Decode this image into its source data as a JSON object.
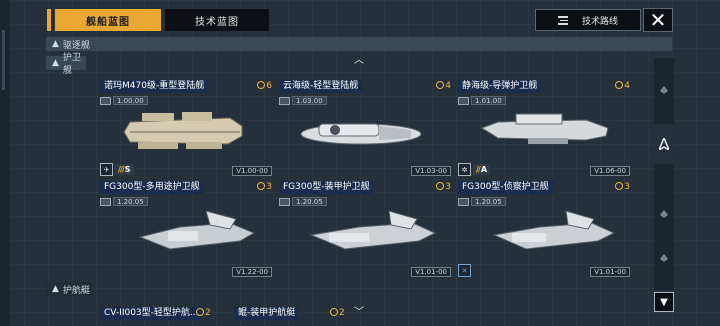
{
  "tabs": {
    "ships": "舰船蓝图",
    "tech": "技术蓝图"
  },
  "header": {
    "route_label": "技术路线",
    "route_icon": "route-list-icon",
    "close_icon": "close-icon"
  },
  "sections": {
    "destroyer": "驱逐舰",
    "frigate": "护卫舰",
    "escort": "护航艇"
  },
  "cards": [
    {
      "title": "诺玛M470级-重型登陆舰",
      "count": "6",
      "version": "1.00.00",
      "code": "V1.00-00",
      "rank": "S",
      "badge_icon": "airstrike-icon"
    },
    {
      "title": "云海级-轻型登陆舰",
      "count": "4",
      "version": "1.03.00",
      "code": "V1.03-00",
      "rank": "",
      "badge_icon": ""
    },
    {
      "title": "静海级-导弹护卫舰",
      "count": "4",
      "version": "1.01.00",
      "code": "V1.06-00",
      "rank": "A",
      "badge_icon": "gear-icon"
    },
    {
      "title": "FG300型-多用途护卫舰",
      "count": "3",
      "version": "1.20.05",
      "code": "V1.22-00",
      "rank": "",
      "badge_icon": ""
    },
    {
      "title": "FG300型-装甲护卫舰",
      "count": "3",
      "version": "1.20.05",
      "code": "V1.01-00",
      "rank": "",
      "badge_icon": ""
    },
    {
      "title": "FG300型-侦察护卫舰",
      "count": "3",
      "version": "1.20.05",
      "code": "V1.01-00",
      "rank": "",
      "badge_icon": "cross-icon"
    }
  ],
  "bottom_cards": [
    {
      "title": "CV-II003型-轻型护航...",
      "count": "2"
    },
    {
      "title": "鲲-装甲护航艇",
      "count": "2"
    }
  ],
  "colors": {
    "accent": "#e8a833",
    "title_bg": "#1b2d4e",
    "coin": "#f2b43a"
  }
}
